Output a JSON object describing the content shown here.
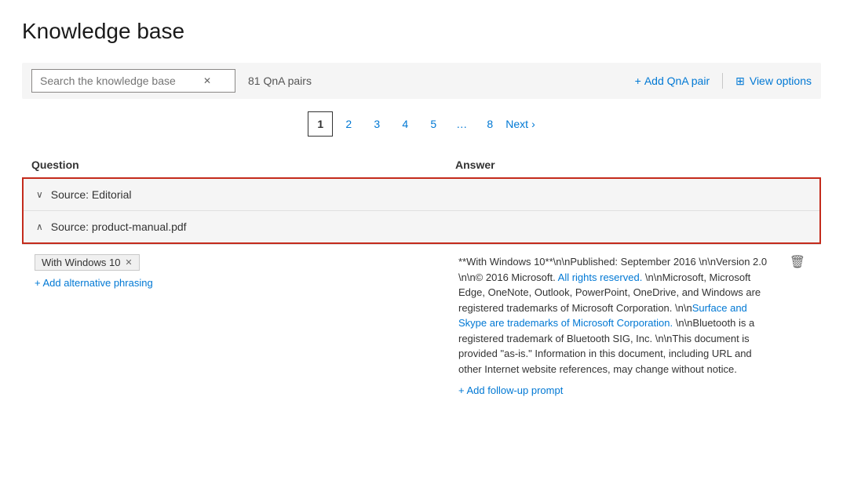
{
  "page": {
    "title": "Knowledge base"
  },
  "toolbar": {
    "search_placeholder": "Search the knowledge base",
    "qna_count": "81 QnA pairs",
    "add_qna_label": "Add QnA pair",
    "view_options_label": "View options"
  },
  "pagination": {
    "pages": [
      "1",
      "2",
      "3",
      "4",
      "5",
      "…",
      "8"
    ],
    "active_page": "1",
    "next_label": "Next"
  },
  "table": {
    "question_header": "Question",
    "answer_header": "Answer"
  },
  "sources": [
    {
      "label": "Source: Editorial",
      "expanded": false,
      "chevron": "∨"
    },
    {
      "label": "Source: product-manual.pdf",
      "expanded": true,
      "chevron": "∧"
    }
  ],
  "qna_item": {
    "question_tag": "With Windows 10",
    "add_alt_label": "+ Add alternative phrasing",
    "answer_text_parts": [
      {
        "text": "**With Windows 10**\\n\\nPublished: September 2016 \\n\\nVersion 2.0 \\n\\n© 2016 Microsoft. ",
        "blue": false
      },
      {
        "text": "All rights reserved.",
        "blue": true
      },
      {
        "text": " \\n\\nMicrosoft, Microsoft Edge, OneNote, Outlook, PowerPoint, OneDrive, and Windows are registered trademarks of Microsoft Corporation. \\n\\n",
        "blue": false
      },
      {
        "text": "Surface and Skype are trademarks of Microsoft Corporation.",
        "blue": true
      },
      {
        "text": " \\n\\nBluetooth is a registered trademark of Bluetooth SIG, Inc. \\n\\nThis document is provided \"as-is.\" Information in this document, including URL and other Internet website references, may change without notice.",
        "blue": false
      }
    ],
    "add_followup_label": "+ Add follow-up prompt"
  },
  "icons": {
    "search": "🔍",
    "close": "✕",
    "plus": "+",
    "grid": "⊞",
    "chevron_right": "›",
    "trash": "🗑"
  }
}
